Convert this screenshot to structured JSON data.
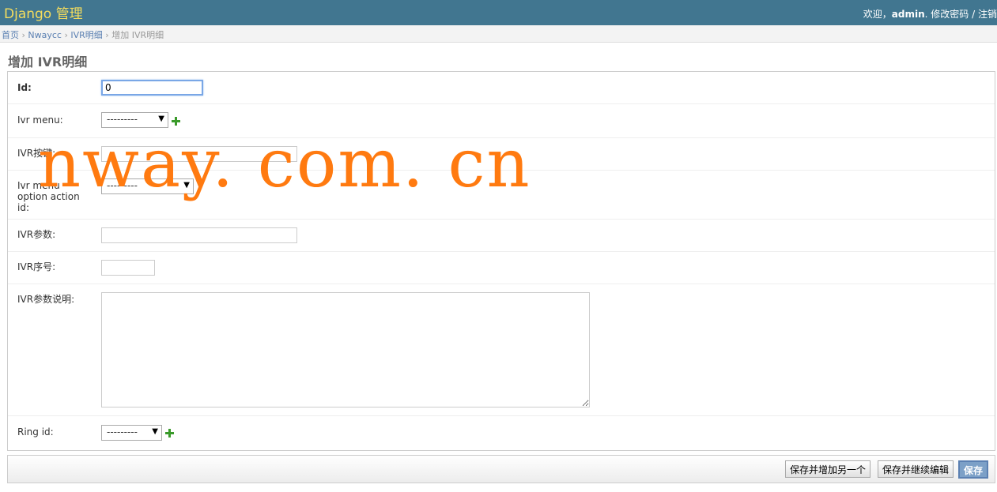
{
  "header": {
    "brand": "Django 管理",
    "welcome": "欢迎，",
    "username": "admin",
    "change_password": "修改密码",
    "separator": " / ",
    "logout": "注销"
  },
  "breadcrumbs": {
    "home": "首页",
    "app": "Nwaycc",
    "model": "IVR明细",
    "current": "增加 IVR明细",
    "sep": " › "
  },
  "page_title": "增加 IVR明细",
  "form": {
    "id": {
      "label": "Id:",
      "value": "0"
    },
    "ivr_menu": {
      "label": "Ivr menu:",
      "selected": "---------"
    },
    "ivr_key": {
      "label": "IVR按键:",
      "value": ""
    },
    "ivr_menu_option_action": {
      "label_1": "Ivr menu",
      "label_2": "option action",
      "label_3": "id:",
      "selected": "---------"
    },
    "ivr_param": {
      "label": "IVR参数:",
      "value": ""
    },
    "ivr_order": {
      "label": "IVR序号:",
      "value": ""
    },
    "ivr_param_desc": {
      "label": "IVR参数说明:",
      "value": ""
    },
    "ring_id": {
      "label": "Ring id:",
      "selected": "---------"
    }
  },
  "buttons": {
    "save_add_another": "保存并增加另一个",
    "save_continue": "保存并继续编辑",
    "save": "保存"
  },
  "watermark": "nway. com. cn",
  "colors": {
    "header_bg": "#417690",
    "brand": "#f5dd5d",
    "link": "#5b80b2",
    "watermark": "#ff7a10",
    "add_icon": "#3a9a2a"
  },
  "icons": {
    "dropdown": "triangle-down",
    "add_related": "green-plus"
  }
}
